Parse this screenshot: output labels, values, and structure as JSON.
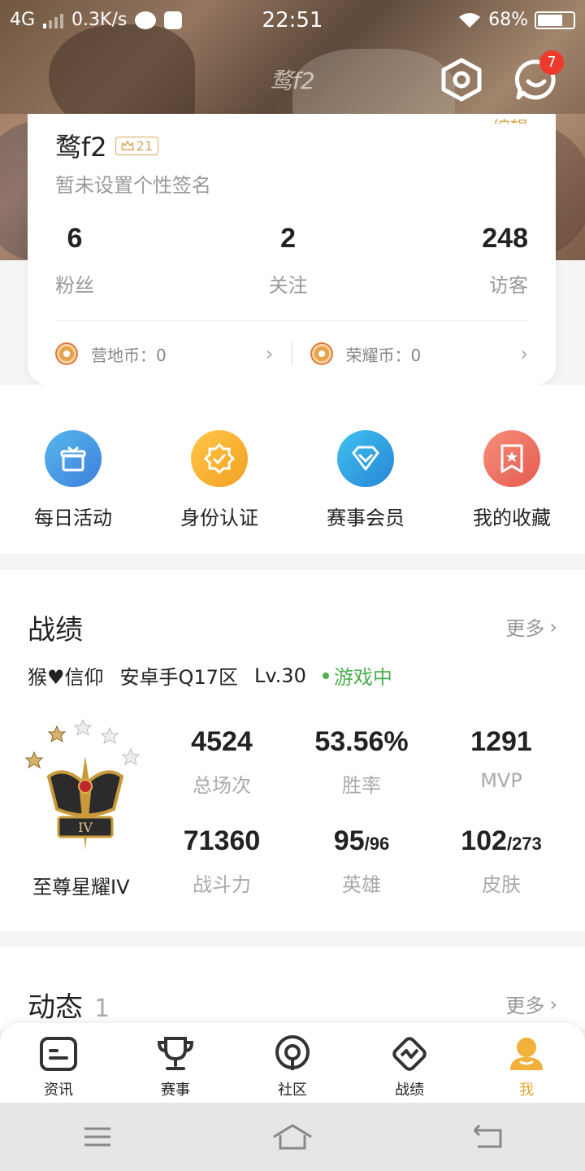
{
  "status_bar": {
    "network": "4G",
    "speed": "0.3K/s",
    "time": "22:51",
    "battery": "68%"
  },
  "header": {
    "watermark": "鹜f2",
    "notification_count": "7"
  },
  "profile": {
    "edit_label": "编辑",
    "name": "鹜f2",
    "level": "21",
    "signature": "暂未设置个性签名",
    "stats": [
      {
        "value": "6",
        "label": "粉丝"
      },
      {
        "value": "2",
        "label": "关注"
      },
      {
        "value": "248",
        "label": "访客"
      }
    ],
    "coins": [
      {
        "label": "营地币：0"
      },
      {
        "label": "荣耀币：0"
      }
    ]
  },
  "quick_actions": [
    {
      "label": "每日活动",
      "color": "#4a90e2",
      "icon": "gift-icon"
    },
    {
      "label": "身份认证",
      "color": "#f6b32b",
      "icon": "badge-check-icon"
    },
    {
      "label": "赛事会员",
      "color": "#2fa7dc",
      "icon": "diamond-icon"
    },
    {
      "label": "我的收藏",
      "color": "#ee7060",
      "icon": "bookmark-star-icon"
    }
  ],
  "record": {
    "title": "战绩",
    "more": "更多",
    "player": "猴♥信仰",
    "server": "安卓手Q17区",
    "level": "Lv.30",
    "status": "游戏中",
    "rank_name": "至尊星耀IV",
    "stats": [
      {
        "value": "4524",
        "sub": "",
        "label": "总场次"
      },
      {
        "value": "53.56%",
        "sub": "",
        "label": "胜率"
      },
      {
        "value": "1291",
        "sub": "",
        "label": "MVP"
      },
      {
        "value": "71360",
        "sub": "",
        "label": "战斗力"
      },
      {
        "value": "95",
        "sub": "/96",
        "label": "英雄"
      },
      {
        "value": "102",
        "sub": "/273",
        "label": "皮肤"
      }
    ]
  },
  "dynamics": {
    "title": "动态",
    "count": "1",
    "more": "更多"
  },
  "bottom_nav": [
    {
      "label": "资讯",
      "icon": "news-icon"
    },
    {
      "label": "赛事",
      "icon": "trophy-icon"
    },
    {
      "label": "社区",
      "icon": "community-icon"
    },
    {
      "label": "战绩",
      "icon": "record-icon"
    },
    {
      "label": "我",
      "icon": "profile-icon"
    }
  ],
  "colors": {
    "accent": "#e6a531",
    "in_game": "#4caf50",
    "badge": "#ee3a2b"
  }
}
